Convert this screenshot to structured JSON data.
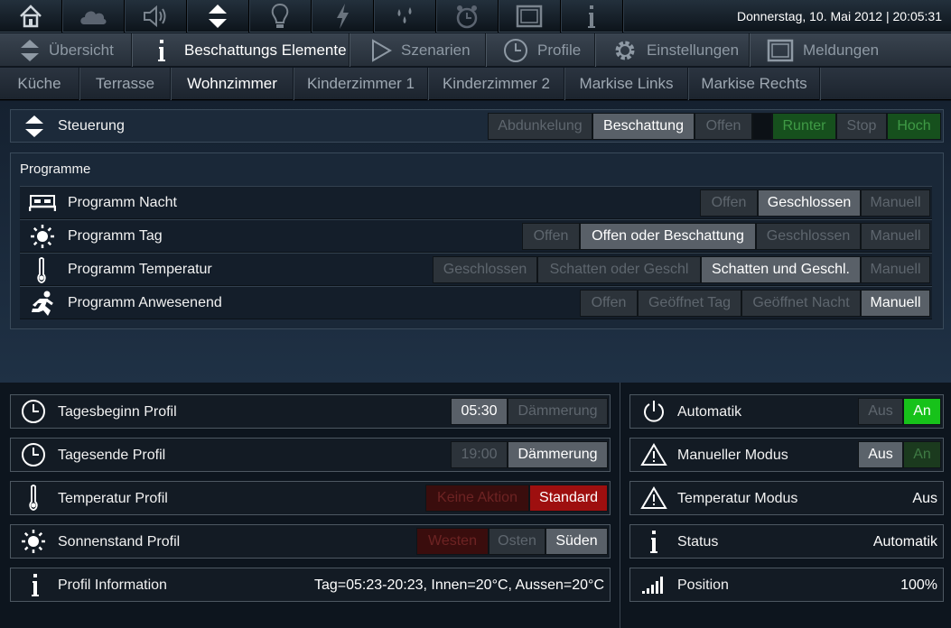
{
  "topbar": {
    "icons": [
      "home-icon",
      "cloud-icon",
      "speaker-icon",
      "updown-arrows-icon",
      "bulb-icon",
      "lightning-icon",
      "drops-icon",
      "alarm-clock-icon",
      "screen-icon",
      "info-icon"
    ],
    "datetime": "Donnerstag, 10. Mai 2012 | 20:05:31"
  },
  "nav": {
    "items": [
      {
        "label": "Übersicht",
        "icon": "updown-arrows-icon"
      },
      {
        "label": "Beschattungs Elemente",
        "icon": "info-icon"
      },
      {
        "label": "Szenarien",
        "icon": "play-icon"
      },
      {
        "label": "Profile",
        "icon": "clock-icon"
      },
      {
        "label": "Einstellungen",
        "icon": "gear-icon"
      },
      {
        "label": "Meldungen",
        "icon": "screen-icon"
      }
    ]
  },
  "subnav": {
    "items": [
      "Küche",
      "Terrasse",
      "Wohnzimmer",
      "Kinderzimmer 1",
      "Kinderzimmer 2",
      "Markise Links",
      "Markise Rechts"
    ]
  },
  "steuerung": {
    "title": "Steuerung",
    "mode_buttons": [
      "Abdunkelung",
      "Beschattung",
      "Offen"
    ],
    "move_buttons": [
      "Runter",
      "Stop",
      "Hoch"
    ]
  },
  "programme": {
    "title": "Programme",
    "rows": [
      {
        "name": "Programm Nacht",
        "options": [
          "Offen",
          "Geschlossen",
          "Manuell"
        ]
      },
      {
        "name": "Programm Tag",
        "options": [
          "Offen",
          "Offen oder Beschattung",
          "Geschlossen",
          "Manuell"
        ]
      },
      {
        "name": "Programm Temperatur",
        "options": [
          "Geschlossen",
          "Schatten oder Geschl",
          "Schatten und Geschl.",
          "Manuell"
        ]
      },
      {
        "name": "Programm Anwesenend",
        "options": [
          "Offen",
          "Geöffnet Tag",
          "Geöffnet Nacht",
          "Manuell"
        ]
      }
    ]
  },
  "profile": {
    "tagesbeginn": {
      "label": "Tagesbeginn Profil",
      "options": [
        "05:30",
        "Dämmerung"
      ]
    },
    "tagesende": {
      "label": "Tagesende Profil",
      "options": [
        "19:00",
        "Dämmerung"
      ]
    },
    "temperatur": {
      "label": "Temperatur Profil",
      "options": [
        "Keine Aktion",
        "Standard"
      ]
    },
    "sonnenstand": {
      "label": "Sonnenstand Profil",
      "options": [
        "Westen",
        "Osten",
        "Süden"
      ]
    },
    "information": {
      "label": "Profil Information",
      "value": "Tag=05:23-20:23, Innen=20°C, Aussen=20°C"
    }
  },
  "status": {
    "automatik": {
      "label": "Automatik",
      "options": [
        "Aus",
        "An"
      ]
    },
    "manuell": {
      "label": "Manueller Modus",
      "options": [
        "Aus",
        "An"
      ]
    },
    "temperatur_modus": {
      "label": "Temperatur Modus",
      "value": "Aus"
    },
    "status": {
      "label": "Status",
      "value": "Automatik"
    },
    "position": {
      "label": "Position",
      "value": "100%"
    }
  }
}
